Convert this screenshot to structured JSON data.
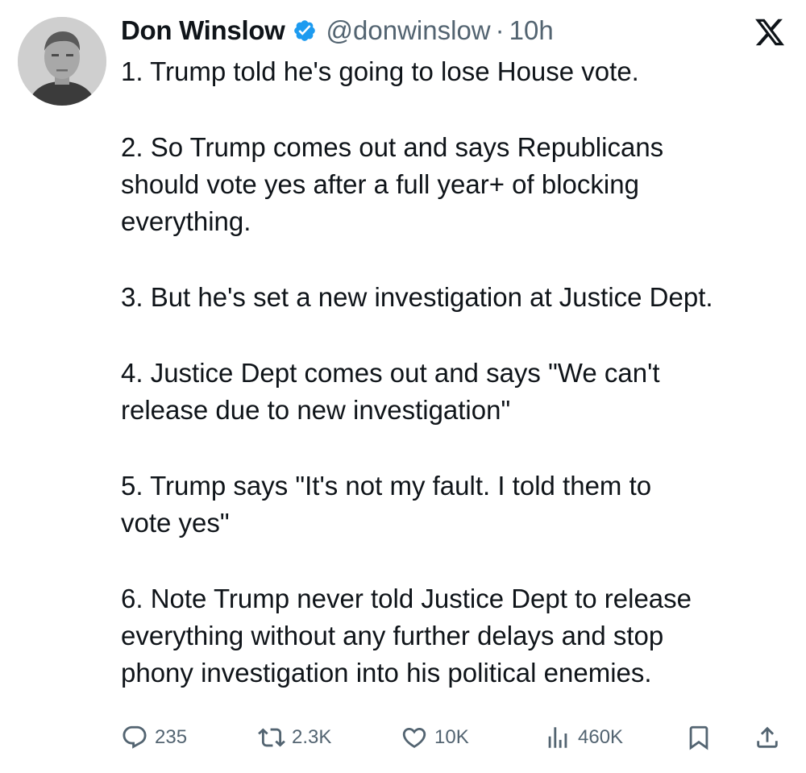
{
  "post": {
    "author": {
      "name": "Don Winslow",
      "handle": "@donwinslow",
      "verified": true,
      "avatar_icon": "profile-photo"
    },
    "separator": "·",
    "time": "10h",
    "platform_icon": "x-logo-icon",
    "paragraphs": [
      "1. Trump told he's going to lose House vote.",
      "2. So Trump comes out and says Republicans\nshould vote yes after a full year+ of blocking\neverything.",
      "3. But he's set a new investigation at Justice Dept.",
      "4. Justice Dept comes out and says \"We can't\nrelease due to new investigation\"",
      "5. Trump says \"It's not my fault. I told them to\nvote yes\"",
      "6. Note Trump never told Justice Dept to release\neverything without any further delays and stop\nphony investigation into his political enemies."
    ],
    "metrics": {
      "replies": "235",
      "reposts": "2.3K",
      "likes": "10K",
      "views": "460K"
    },
    "icons": {
      "reply": "reply-icon",
      "repost": "repost-icon",
      "like": "heart-icon",
      "views": "views-icon",
      "bookmark": "bookmark-icon",
      "share": "share-icon"
    },
    "colors": {
      "text_primary": "#0f1419",
      "text_secondary": "#536471",
      "verified_blue": "#1d9bf0"
    }
  }
}
